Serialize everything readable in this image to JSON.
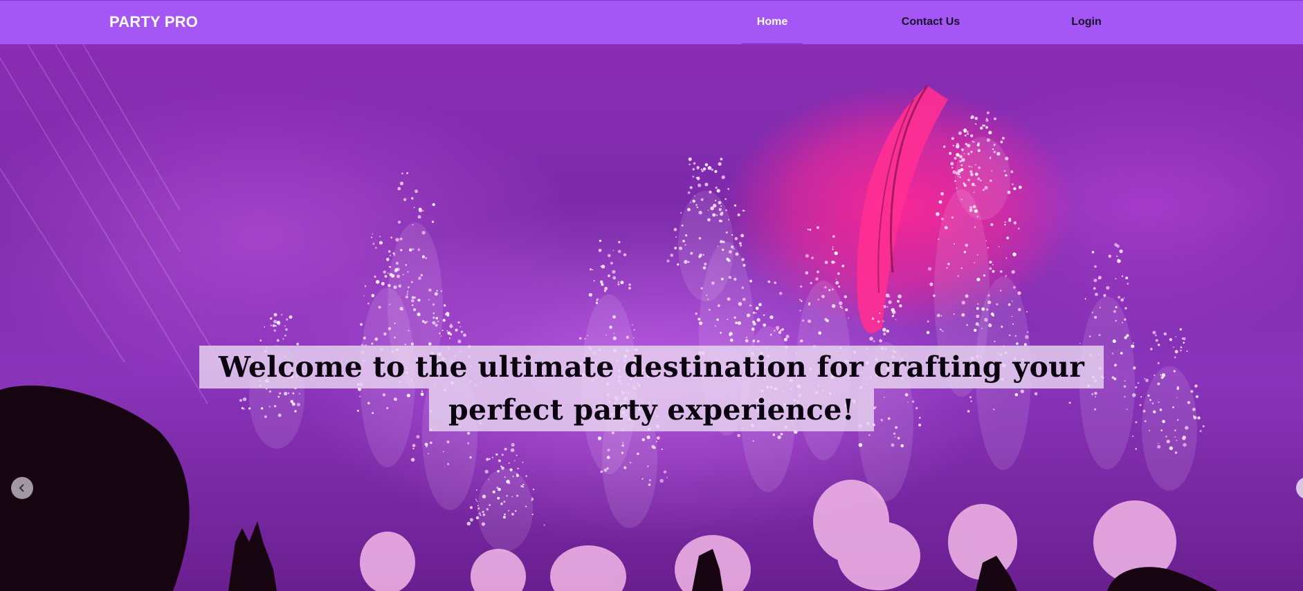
{
  "navbar": {
    "brand": "PARTY PRO",
    "links": [
      {
        "label": "Home",
        "active": true
      },
      {
        "label": "Contact Us",
        "active": false
      },
      {
        "label": "Login",
        "active": false
      }
    ],
    "background_color": "#a557f6"
  },
  "hero": {
    "headline_line1": "Welcome to the ultimate destination for crafting your",
    "headline_line2": "perfect party experience!",
    "image_subject": "concert stage with fireworks sparklers and purple smoke",
    "prev_icon": "chevron-left-icon",
    "next_icon": "chevron-right-icon"
  }
}
